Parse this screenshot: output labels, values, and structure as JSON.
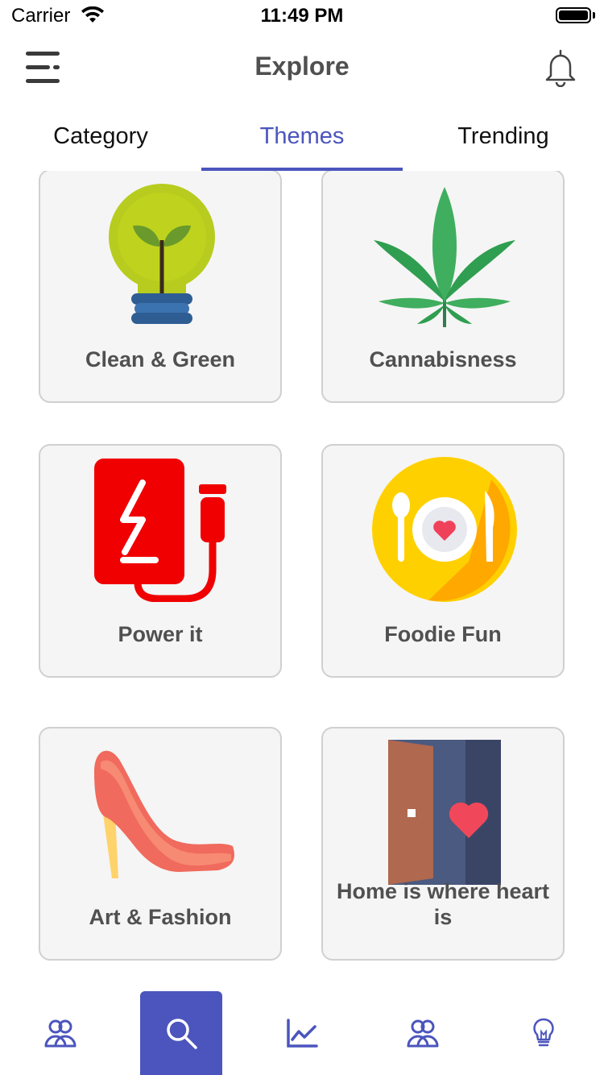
{
  "status_bar": {
    "carrier": "Carrier",
    "time": "11:49 PM"
  },
  "header": {
    "title": "Explore"
  },
  "tabs": [
    {
      "label": "Category",
      "active": false
    },
    {
      "label": "Themes",
      "active": true
    },
    {
      "label": "Trending",
      "active": false
    }
  ],
  "themes": [
    {
      "label": "Clean & Green",
      "icon": "lightbulb-plant-icon"
    },
    {
      "label": "Cannabisness",
      "icon": "cannabis-leaf-icon"
    },
    {
      "label": "Power it",
      "icon": "power-bank-icon"
    },
    {
      "label": "Foodie Fun",
      "icon": "plate-cutlery-icon"
    },
    {
      "label": "Art & Fashion",
      "icon": "high-heel-icon"
    },
    {
      "label": "Home is where heart is",
      "icon": "door-heart-icon"
    }
  ],
  "bottom_nav": [
    {
      "name": "community",
      "icon": "users-icon",
      "active": false
    },
    {
      "name": "explore",
      "icon": "search-icon",
      "active": true
    },
    {
      "name": "stats",
      "icon": "line-chart-icon",
      "active": false
    },
    {
      "name": "groups",
      "icon": "users-icon",
      "active": false
    },
    {
      "name": "ideas",
      "icon": "lightbulb-icon",
      "active": false
    }
  ],
  "colors": {
    "accent": "#4b55bd",
    "card_bg": "#f5f5f5",
    "card_border": "#d0d0d0",
    "label": "#505050"
  }
}
